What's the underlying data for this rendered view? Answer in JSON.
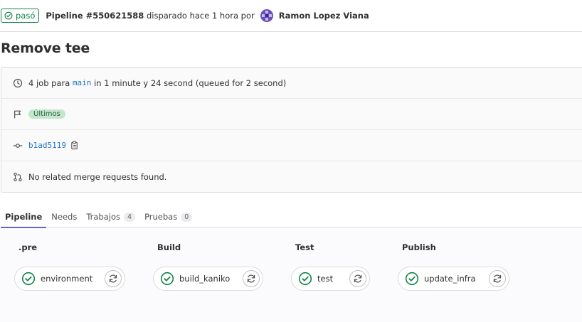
{
  "header": {
    "status_label": "pasó",
    "pipeline_label": "Pipeline #550621588",
    "triggered_text": "disparado hace 1 hora por",
    "author": "Ramon Lopez Viana"
  },
  "title": "Remove tee",
  "info": {
    "jobs_prefix": "4 job para",
    "branch": "main",
    "duration_text": "in 1 minute y 24 second (queued for 2 second)",
    "latest_badge": "Últimos",
    "commit_sha": "b1ad5119",
    "merge_text": "No related merge requests found."
  },
  "tabs": [
    {
      "label": "Pipeline",
      "active": true
    },
    {
      "label": "Needs"
    },
    {
      "label": "Trabajos",
      "count": "4"
    },
    {
      "label": "Pruebas",
      "count": "0"
    }
  ],
  "stages": [
    {
      "name": ".pre",
      "job": "environment"
    },
    {
      "name": "Build",
      "job": "build_kaniko"
    },
    {
      "name": "Test",
      "job": "test"
    },
    {
      "name": "Publish",
      "job": "update_infra"
    }
  ],
  "colors": {
    "success": "#108548",
    "link": "#1f75cb",
    "tab_active": "#6666c4"
  },
  "icons": {
    "status": "status-success-icon",
    "clock": "clock-icon",
    "flag": "flag-icon",
    "commit": "commit-icon",
    "merge": "merge-request-icon",
    "copy": "copy-icon",
    "retry": "retry-icon"
  }
}
